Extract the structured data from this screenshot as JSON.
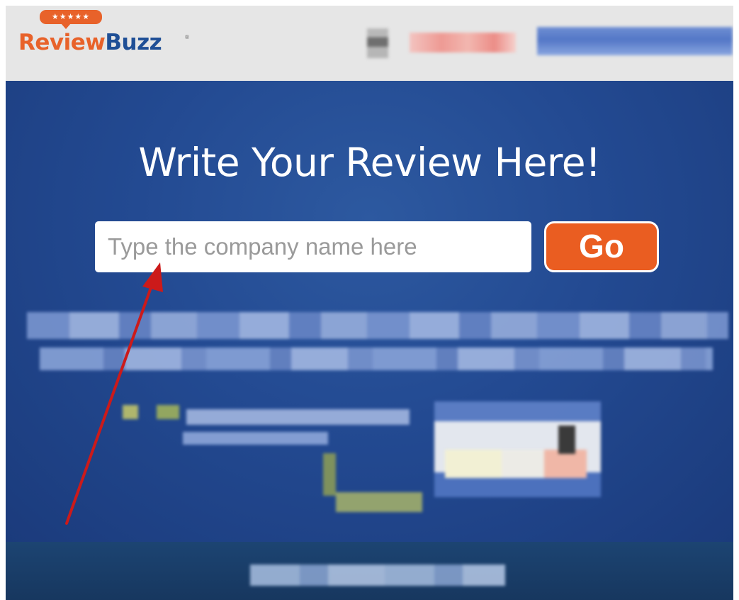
{
  "header": {
    "logo": {
      "stars": "★★★★★",
      "name_part1": "Review",
      "name_part2": "Buzz",
      "registered_mark": "®"
    }
  },
  "hero": {
    "title": "Write Your Review Here!",
    "search": {
      "placeholder": "Type the company name here",
      "value": ""
    },
    "go_label": "Go"
  },
  "colors": {
    "brand_orange": "#ea5d21",
    "brand_blue": "#1f4f96",
    "hero_background": "#234a92",
    "annotation_red": "#cc1a1a"
  },
  "annotation": {
    "type": "arrow",
    "color": "red",
    "points_to": "search-input"
  }
}
